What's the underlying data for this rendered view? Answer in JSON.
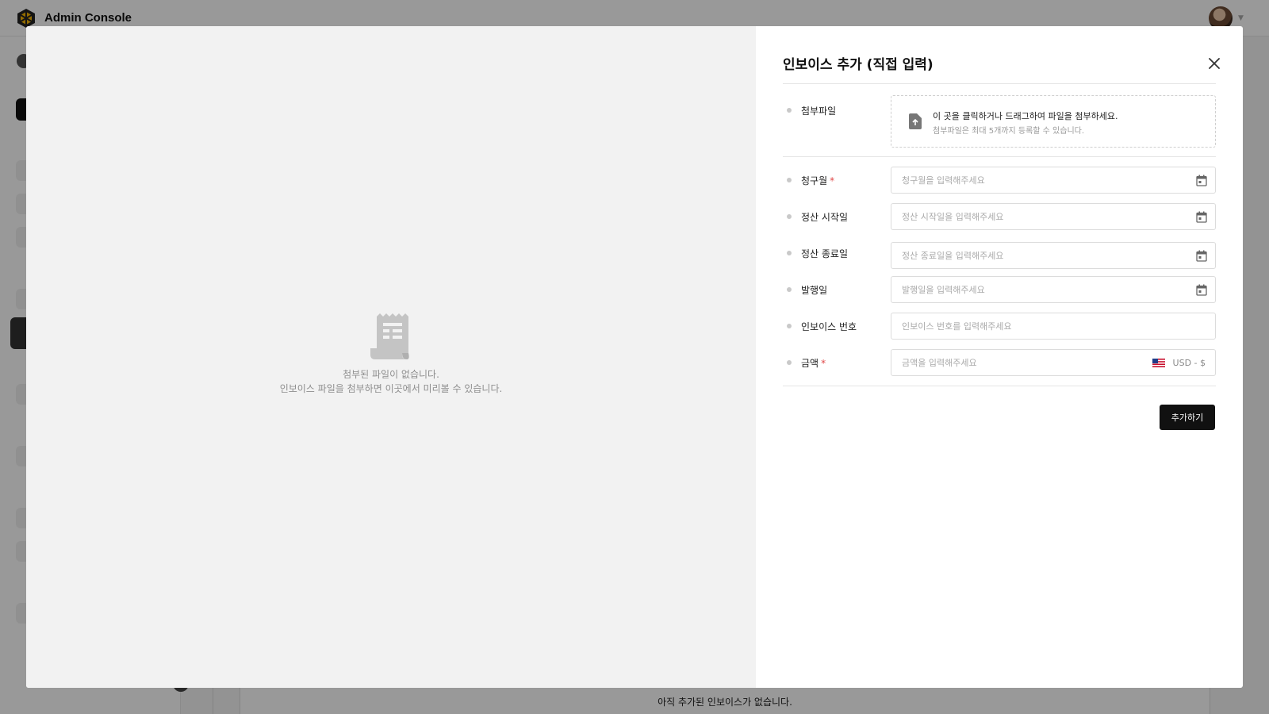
{
  "app": {
    "title": "Admin Console"
  },
  "background": {
    "empty_invoices_text": "아직 추가된 인보이스가 없습니다."
  },
  "modal": {
    "title": "인보이스 추가 (직접 입력)",
    "preview": {
      "empty_line1": "첨부된 파일이 없습니다.",
      "empty_line2": "인보이스 파일을 첨부하면 이곳에서 미리볼 수 있습니다."
    },
    "attachment": {
      "label": "첨부파일",
      "main_text": "이 곳을 클릭하거나 드래그하여 파일을 첨부하세요.",
      "sub_text": "첨부파일은 최대 5개까지 등록할 수 있습니다."
    },
    "fields": {
      "billing_month": {
        "label": "청구월",
        "required_mark": "*",
        "placeholder": "청구월을 입력해주세요",
        "value": ""
      },
      "settlement_start": {
        "label": "정산 시작일",
        "placeholder": "정산 시작일을 입력해주세요",
        "value": ""
      },
      "settlement_end": {
        "label": "정산 종료일",
        "placeholder": "정산 종료일을 입력해주세요",
        "value": ""
      },
      "issue_date": {
        "label": "발행일",
        "placeholder": "발행일을 입력해주세요",
        "value": ""
      },
      "invoice_number": {
        "label": "인보이스 번호",
        "placeholder": "인보이스 번호를 입력해주세요",
        "value": ""
      },
      "amount": {
        "label": "금액",
        "required_mark": "*",
        "placeholder": "금액을 입력해주세요",
        "value": "",
        "currency": "USD - $"
      }
    },
    "submit_label": "추가하기"
  },
  "icons": {
    "close": "close-icon",
    "calendar": "calendar-icon",
    "file_upload": "file-upload-icon",
    "receipt": "receipt-icon",
    "flag": "us-flag-icon"
  },
  "colors": {
    "required": "#e04848",
    "primary_button": "#111111",
    "preview_bg": "#f2f2f2"
  }
}
